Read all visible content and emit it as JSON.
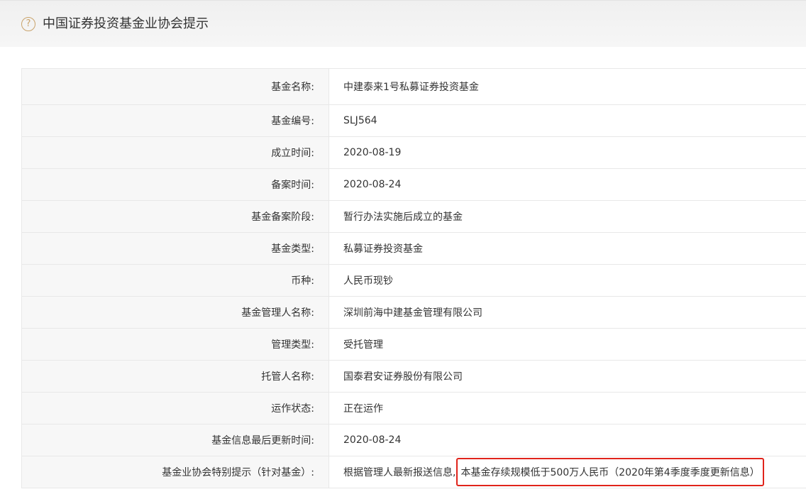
{
  "header": {
    "icon": "question-circle-icon",
    "title": "中国证券投资基金业协会提示"
  },
  "rows": [
    {
      "label": "基金名称:",
      "value": "中建泰来1号私募证券投资基金"
    },
    {
      "label": "基金编号:",
      "value": "SLJ564"
    },
    {
      "label": "成立时间:",
      "value": "2020-08-19"
    },
    {
      "label": "备案时间:",
      "value": "2020-08-24"
    },
    {
      "label": "基金备案阶段:",
      "value": "暂行办法实施后成立的基金"
    },
    {
      "label": "基金类型:",
      "value": "私募证券投资基金"
    },
    {
      "label": "币种:",
      "value": "人民币现钞"
    },
    {
      "label": "基金管理人名称:",
      "value": "深圳前海中建基金管理有限公司"
    },
    {
      "label": "管理类型:",
      "value": "受托管理"
    },
    {
      "label": "托管人名称:",
      "value": "国泰君安证券股份有限公司"
    },
    {
      "label": "运作状态:",
      "value": "正在运作"
    },
    {
      "label": "基金信息最后更新时间:",
      "value": "2020-08-24"
    }
  ],
  "special_notice": {
    "label": "基金业协会特别提示（针对基金）:",
    "prefix": "根据管理人最新报送信息,",
    "highlight": "本基金存续规模低于500万人民币（2020年第4季度季度更新信息）",
    "highlight_color": "#e0241b"
  },
  "colors": {
    "label_bg": "#f7f7f7",
    "border": "#e8e8e8",
    "icon_accent": "#c9a36b"
  }
}
